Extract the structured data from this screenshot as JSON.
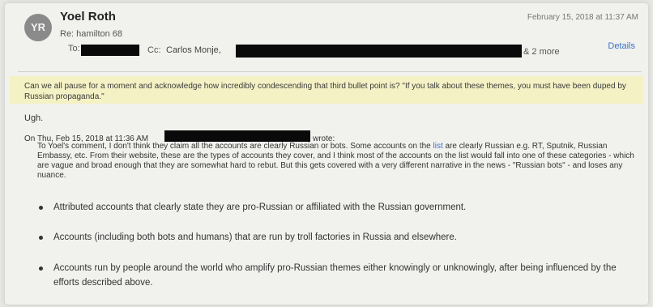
{
  "email": {
    "avatar_initials": "YR",
    "sender": "Yoel Roth",
    "subject": "Re: hamilton 68",
    "to_label": "To:",
    "cc_label": "Cc:",
    "cc_name": "Carlos Monje,",
    "cc_more": "& 2 more",
    "date": "February 15, 2018 at 11:37 AM",
    "details_label": "Details"
  },
  "body": {
    "highlight_text": "Can we all pause for a moment and acknowledge how incredibly condescending that third bullet point is? \"If you talk about these themes, you must have been duped by Russian propaganda.\"",
    "reply": "Ugh.",
    "quote_header": "On Thu, Feb 15, 2018 at 11:36 AM",
    "quote_wrote": "wrote:",
    "quote_before_link": "To Yoel's comment, I don't think they claim all the accounts are clearly Russian or bots. Some accounts on the ",
    "quote_link": "list",
    "quote_after_link": " are clearly Russian e.g. RT, Sputnik, Russian Embassy, etc. From their website, these are the types of accounts they cover, and I think most of the accounts on the list would fall into one of these categories - which are vague and broad enough that they are somewhat hard to rebut. But this gets covered with a very different narrative in the news - \"Russian bots\" - and loses any nuance.",
    "bullets": [
      "Attributed accounts that clearly state they are pro-Russian or affiliated with the Russian government.",
      "Accounts (including both bots and humans) that are run by troll factories in Russia and elsewhere.",
      "Accounts run by people around the world who amplify pro-Russian themes either knowingly or unknowingly, after being influenced by the efforts described above."
    ]
  },
  "colors": {
    "background": "#f1f1ee",
    "highlight": "#f4f1c5",
    "link": "#3a73c9",
    "redaction": "#0a0a0a"
  }
}
